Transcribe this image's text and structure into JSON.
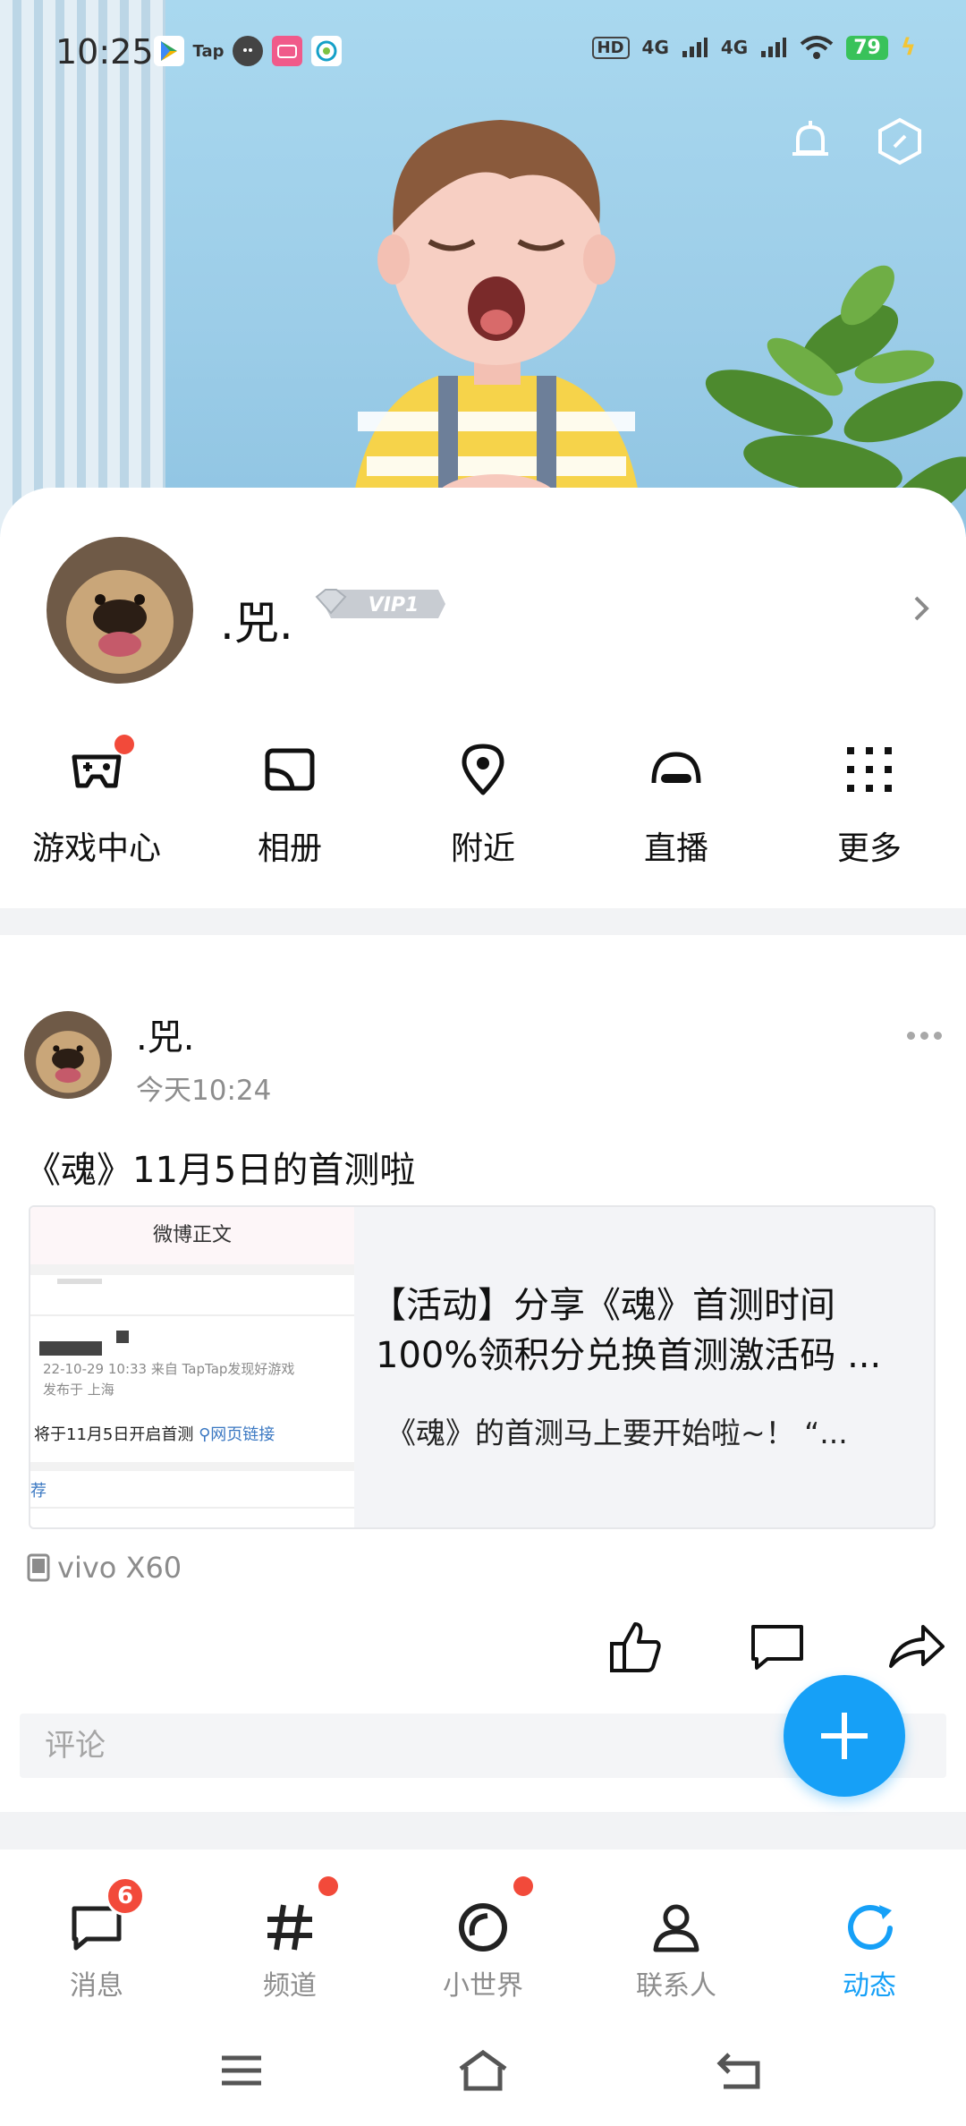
{
  "status_bar": {
    "time": "10:25",
    "app_icons": [
      "google-play-icon",
      "taptap-icon",
      "qq-penguin-icon",
      "bilibili-icon",
      "china-mobile-icon"
    ],
    "tap_label": "Tap",
    "hd_label": "HD",
    "signal_1": "4G",
    "signal_2": "4G",
    "battery": "79"
  },
  "hero": {
    "icons": [
      "bell-icon",
      "hexagon-settings-icon"
    ]
  },
  "profile": {
    "nickname": ".兕.",
    "vip_label": "VIP1",
    "shortcuts": [
      {
        "label": "游戏中心",
        "icon": "gamepad-icon",
        "has_dot": true
      },
      {
        "label": "相册",
        "icon": "album-icon",
        "has_dot": false
      },
      {
        "label": "附近",
        "icon": "location-pin-icon",
        "has_dot": false
      },
      {
        "label": "直播",
        "icon": "live-icon",
        "has_dot": false
      },
      {
        "label": "更多",
        "icon": "grid-dots-icon",
        "has_dot": false
      }
    ]
  },
  "post": {
    "author": ".兕.",
    "time": "今天10:24",
    "text": "《魂》11月5日的首测啦",
    "card": {
      "thumb_header": "微博正文",
      "thumb_meta_1": "22-10-29 10:33  来自 TapTap发现好游戏",
      "thumb_meta_2": "发布于 上海",
      "thumb_line": "将于11月5日开启首测",
      "thumb_link": "网页链接",
      "thumb_rec": "荐",
      "title_line1": "【活动】分享《魂》首测时间",
      "title_line2": "100%领积分兑换首测激活码 ...",
      "desc": "《魂》的首测马上要开始啦~！  “..."
    },
    "device": "vivo X60",
    "comment_placeholder": "评论"
  },
  "tabbar": {
    "tabs": [
      {
        "label": "消息",
        "icon": "message-icon",
        "badge": "6",
        "active": false
      },
      {
        "label": "频道",
        "icon": "hashtag-icon",
        "badge": "",
        "dot": true,
        "active": false
      },
      {
        "label": "小世界",
        "icon": "small-world-icon",
        "badge": "",
        "dot": true,
        "active": false
      },
      {
        "label": "联系人",
        "icon": "contacts-icon",
        "badge": "",
        "active": false
      },
      {
        "label": "动态",
        "icon": "feed-refresh-icon",
        "badge": "",
        "active": true
      }
    ]
  },
  "colors": {
    "accent": "#16a0f7",
    "badge_red": "#f24a3a",
    "battery_green": "#39c25a"
  }
}
